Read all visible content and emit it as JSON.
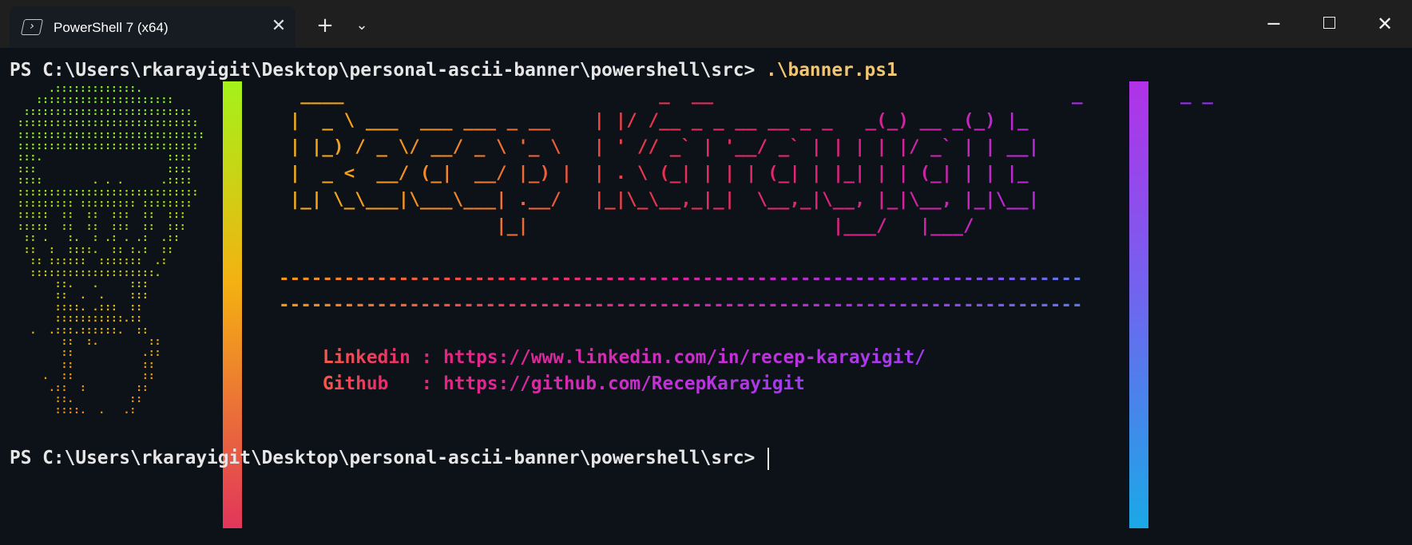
{
  "window": {
    "tab_title": "PowerShell 7 (x64)",
    "tab_icon": "powershell-icon",
    "tab_icon_glyph": "›",
    "close_tab_glyph": "✕",
    "new_tab_glyph": "+",
    "tab_menu_glyph": "⌄",
    "minimize_glyph": "─",
    "close_glyph": "✕"
  },
  "terminal": {
    "prompt": "PS C:\\Users\\rkarayigit\\Desktop\\personal-ascii-banner\\powershell\\src> ",
    "command": ".\\banner.ps1",
    "final_prompt": "PS C:\\Users\\rkarayigit\\Desktop\\personal-ascii-banner\\powershell\\src> "
  },
  "banner": {
    "portrait_art": "      .:::::::::::::.\n    ::::::::::::::::::::::\n  :::::::::::::::::::::::::::\n :::::::::::::::::::::::::::::\n ::::::::::::::::::::::::::::::\n :::::::::::::::::::::::::::::\n :::.                    ::::\n :::                     ::::\n ::::        . . .      .::::\n :::::::::::::::::::::::::::::\n ::::::::: ::::::::: ::::::::\n :::::  ::  ::  :::  ::  :::\n :::::  ::  ::  :::  ::  :::\n  :: .   :.  : .: . .:  .::\n  ::  :  ::::.  :: :.:  ::\n   :: ::::::  :::::::  .:\n   ::::::::::::::::::::.\n       ::.   .     :::\n       ::  .  .    :::\n       ::::. .:::  ::\n       :::::::::::.::\n   .  .:::.::::::.  ::\n        ::  :.        ::\n        ::           .::\n        ::           ::\n     .  ::           ::\n      .::  :        ::\n       ::.         ::\n       ::::.  .   .:",
    "bar_text": "||\n||\n||\n||\n||\n||\n||\n||\n||\n||\n||\n||\n||\n||",
    "name_art": "  ____                             _  __                                 _         _ _\n |  _ \\ ___  ___ ___ _ __    | |/ /__ _ _ __ __ _ _   _(_) __ _(_) |_\n | |_) / _ \\/ __/ _ \\ '_ \\   | ' // _` | '__/ _` | | | | |/ _` | | __|\n |  _ <  __/ (_|  __/ |_) |  | . \\ (_| | | | (_| | |_| | | (_| | | |_\n |_| \\_\\___|\\___\\___| .__/   |_|\\_\\__,_|_|  \\__,_|\\__, |_|\\__, |_|\\__|\n                    |_|                            |___/   |___/",
    "dash_line": "--------------------------------------------------------------------------",
    "linkedin_label": "Linkedin",
    "linkedin_sep": " : ",
    "linkedin_url": "https://www.linkedin.com/in/recep-karayigit/",
    "github_label": "Github",
    "github_sep": "   : ",
    "github_url": "https://github.com/RecepKarayigit"
  }
}
